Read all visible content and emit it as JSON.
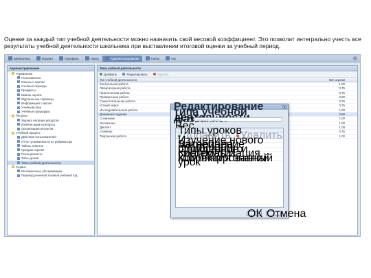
{
  "caption": "Оценке за каждый тип учебной деятельности можно назначить свой весовой коэффициент. Это позволит интегрально учесть все результаты учебной деятельности школьника при выставлении итоговой оценки за учебный период.",
  "topnav": [
    {
      "label": "Библиотека",
      "active": false
    },
    {
      "label": "Журнал",
      "active": false
    },
    {
      "label": "Портфель",
      "active": false
    },
    {
      "label": "Поиск",
      "active": false
    },
    {
      "label": "Администрирование",
      "active": true
    },
    {
      "label": "Поиск",
      "active": false
    },
    {
      "label": "Чат",
      "active": false
    }
  ],
  "sidebar": {
    "title": "Администрирование",
    "items": [
      {
        "label": "Управление",
        "level": 0,
        "expander": "−",
        "folder": true
      },
      {
        "label": "Пользователи",
        "level": 1
      },
      {
        "label": "Классы и группы",
        "level": 1
      },
      {
        "label": "Учебные периоды",
        "level": 1
      },
      {
        "label": "Предметы",
        "level": 1
      },
      {
        "label": "Шкалы оценок",
        "level": 1
      },
      {
        "label": "Журнальные страницы",
        "level": 1
      },
      {
        "label": "Информация о школе",
        "level": 1
      },
      {
        "label": "Учебный план",
        "level": 1
      },
      {
        "label": "Учебные процедуры",
        "level": 1
      },
      {
        "label": "Ресурсы",
        "level": 0,
        "expander": "−",
        "folder": true
      },
      {
        "label": "Журнал нагрузки ресурсов",
        "level": 1
      },
      {
        "label": "Компенсации и ресурсы",
        "level": 1
      },
      {
        "label": "Организация ресурсов",
        "level": 1
      },
      {
        "label": "Учебный процесс",
        "level": 0,
        "expander": "−",
        "folder": true
      },
      {
        "label": "Действия пользователей",
        "level": 1
      },
      {
        "label": "Отчет успеваемости по рубрикатору",
        "level": 1
      },
      {
        "label": "Табель отметок",
        "level": 1
      },
      {
        "label": "Средние оценки",
        "level": 1
      },
      {
        "label": "Посещаемость",
        "level": 1
      },
      {
        "label": "Типы уроков",
        "level": 1
      },
      {
        "label": "Типы учебной деятельности",
        "level": 1,
        "selected": true
      },
      {
        "label": "Сервис",
        "level": 0,
        "expander": "−",
        "folder": true
      },
      {
        "label": "Регламентное обслуживание",
        "level": 1
      },
      {
        "label": "Перевод учеников в новый учебный год",
        "level": 1
      }
    ]
  },
  "main": {
    "title": "Типы учебной деятельности",
    "toolbar": {
      "add": "Добавить",
      "edit": "Редактировать",
      "delete": "Удалить"
    },
    "columns": {
      "type": "Тип учебной деятельности",
      "weight": "Вес оценки"
    },
    "rows": [
      {
        "type": "Контрольная работа",
        "weight": "1,00"
      },
      {
        "type": "Лабораторная работа",
        "weight": "0,75"
      },
      {
        "type": "Практическая работа",
        "weight": "0,75"
      },
      {
        "type": "Проверочная работа",
        "weight": "0,80"
      },
      {
        "type": "Самостоятельная работа",
        "weight": "0,75"
      },
      {
        "type": "Устный опрос",
        "weight": "0,75"
      },
      {
        "type": "Исследовательская работа",
        "weight": "1,00"
      },
      {
        "type": "Домашнее задание",
        "weight": "0,50",
        "selected": true
      },
      {
        "type": "Сочинение",
        "weight": "1,00"
      },
      {
        "type": "Изложение",
        "weight": "1,00"
      },
      {
        "type": "Диктант",
        "weight": "1,00"
      },
      {
        "type": "Семинар",
        "weight": "0,75"
      },
      {
        "type": "Творческая работа",
        "weight": "1,00"
      }
    ]
  },
  "dialog": {
    "title": "Редактирование типа учебной деятельности",
    "name_label": "Название:",
    "name_value": "Домашнее задание",
    "weight_label": "Вес оценки:",
    "weight_value": "0,50",
    "weight_fraction": 0.5,
    "lesson_types_legend": "Типы уроков",
    "add": "Добавить",
    "delete": "Удалить",
    "lesson_types": [
      "Изучение нового материала",
      "Закрепление пройденного",
      "Обобщение и систематизация",
      "Контроль и коррекция знаний",
      "Комбинированный урок"
    ],
    "ok": "ОК",
    "cancel": "Отмена"
  }
}
